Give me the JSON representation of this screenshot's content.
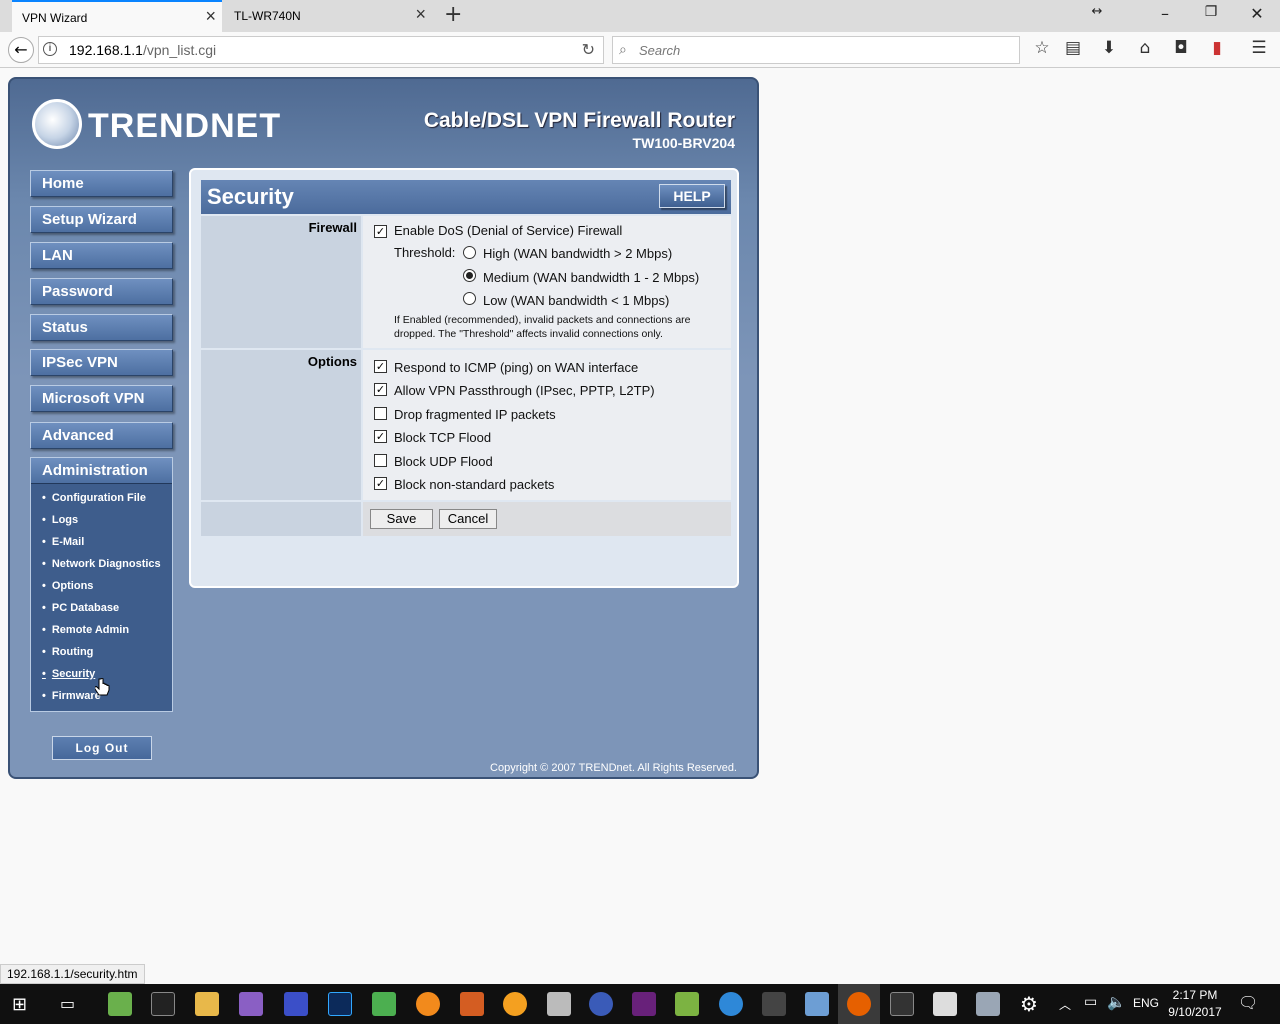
{
  "browser": {
    "tabs": [
      {
        "label": "VPN Wizard"
      },
      {
        "label": "TL-WR740N"
      }
    ],
    "url_host": "192.168.1.1",
    "url_path": "/vpn_list.cgi",
    "search_placeholder": "Search",
    "status_url": "192.168.1.1/security.htm"
  },
  "router": {
    "brand": "TRENDNET",
    "product_title": "Cable/DSL VPN Firewall Router",
    "model": "TW100-BRV204",
    "nav": [
      "Home",
      "Setup Wizard",
      "LAN",
      "Password",
      "Status",
      "IPSec VPN",
      "Microsoft VPN",
      "Advanced"
    ],
    "admin": {
      "label": "Administration",
      "items": [
        "Configuration File",
        "Logs",
        "E-Mail",
        "Network Diagnostics",
        "Options",
        "PC Database",
        "Remote Admin",
        "Routing",
        "Security",
        "Firmware"
      ]
    },
    "logout": "Log Out",
    "copyright": "Copyright © 2007 TRENDnet. All Rights Reserved."
  },
  "security": {
    "title": "Security",
    "help": "HELP",
    "firewall": {
      "label": "Firewall",
      "enable_dos": {
        "label": "Enable DoS (Denial of Service) Firewall",
        "checked": true
      },
      "threshold_label": "Threshold:",
      "options": [
        {
          "label": "High (WAN bandwidth > 2 Mbps)",
          "selected": false
        },
        {
          "label": "Medium (WAN bandwidth 1 - 2 Mbps)",
          "selected": true
        },
        {
          "label": "Low (WAN bandwidth < 1 Mbps)",
          "selected": false
        }
      ],
      "note_1": "If Enabled (recommended), invalid packets and connections are",
      "note_2": "dropped. The \"Threshold\" affects invalid connections only."
    },
    "options": {
      "label": "Options",
      "items": [
        {
          "label": "Respond to ICMP (ping) on WAN interface",
          "checked": true
        },
        {
          "label": "Allow VPN Passthrough (IPsec, PPTP, L2TP)",
          "checked": true
        },
        {
          "label": "Drop fragmented IP packets",
          "checked": false
        },
        {
          "label": "Block TCP Flood",
          "checked": true
        },
        {
          "label": "Block UDP Flood",
          "checked": false
        },
        {
          "label": "Block non-standard packets",
          "checked": true
        }
      ]
    },
    "save": "Save",
    "cancel": "Cancel"
  },
  "taskbar": {
    "lang": "ENG",
    "time": "2:17 PM",
    "date": "9/10/2017"
  }
}
